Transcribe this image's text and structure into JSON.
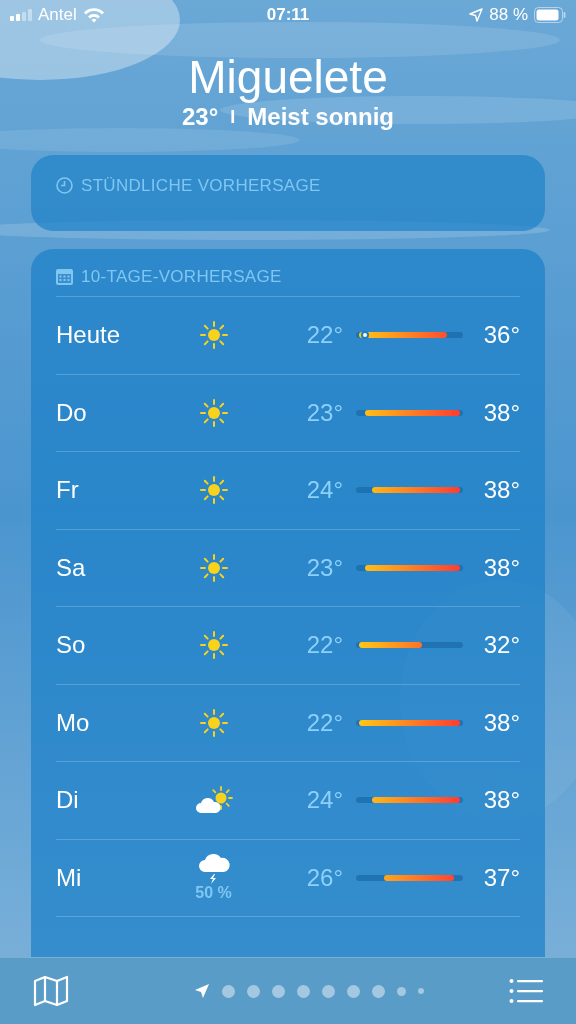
{
  "status_bar": {
    "carrier": "Antel",
    "time": "07:11",
    "battery": "88 %"
  },
  "location": {
    "name": "Miguelete",
    "temperature": "23°",
    "separator": "I",
    "condition": "Meist sonnig"
  },
  "hourly_forecast": {
    "title": "STÜNDLICHE VORHERSAGE"
  },
  "daily_forecast": {
    "title": "10-TAGE-VORHERSAGE",
    "days": [
      {
        "day": "Heute",
        "kind": "sunny",
        "low": "22°",
        "high": "36°",
        "current": true
      },
      {
        "day": "Do",
        "kind": "sunny",
        "low": "23°",
        "high": "38°",
        "current": false
      },
      {
        "day": "Fr",
        "kind": "sunny",
        "low": "24°",
        "high": "38°",
        "current": false
      },
      {
        "day": "Sa",
        "kind": "sunny",
        "low": "23°",
        "high": "38°",
        "current": false
      },
      {
        "day": "So",
        "kind": "sunny",
        "low": "22°",
        "high": "32°",
        "current": false
      },
      {
        "day": "Mo",
        "kind": "sunny",
        "low": "22°",
        "high": "38°",
        "current": false
      },
      {
        "day": "Di",
        "kind": "partly_cloudy",
        "low": "24°",
        "high": "38°",
        "current": false
      },
      {
        "day": "Mi",
        "kind": "thunderstorm",
        "precipitation": "50 %",
        "low": "26°",
        "high": "37°",
        "current": false
      }
    ]
  },
  "page_indicator": [
    {
      "kind": "location",
      "selected": true
    },
    {
      "kind": "dot",
      "selected": false
    },
    {
      "kind": "dot",
      "selected": false
    },
    {
      "kind": "dot",
      "selected": false
    },
    {
      "kind": "dot",
      "selected": false
    },
    {
      "kind": "dot",
      "selected": false
    },
    {
      "kind": "dot",
      "selected": false
    },
    {
      "kind": "dot",
      "selected": false
    },
    {
      "kind": "small_dot",
      "selected": false
    },
    {
      "kind": "tiny_dot",
      "selected": false
    }
  ]
}
